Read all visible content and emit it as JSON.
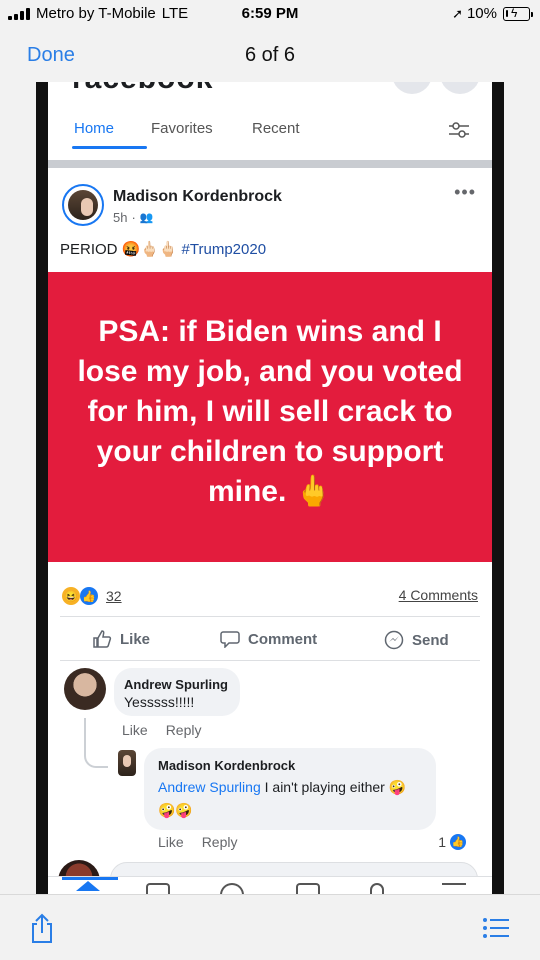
{
  "status_bar": {
    "carrier": "Metro by T-Mobile",
    "network": "LTE",
    "time": "6:59 PM",
    "battery": "10%",
    "battery_level": 0.1
  },
  "viewer": {
    "done_label": "Done",
    "counter": "6 of 6"
  },
  "facebook": {
    "logo_partial": "racebook",
    "tabs": [
      {
        "label": "Home",
        "active": true
      },
      {
        "label": "Favorites",
        "active": false
      },
      {
        "label": "Recent",
        "active": false
      }
    ],
    "post": {
      "author": "Madison Kordenbrock",
      "time": "5h",
      "text_prefix": "PERIOD",
      "emojis": "🤬🖕🏻🖕🏻",
      "hashtag": "#Trump2020",
      "image_text": "PSA: if Biden wins and I lose my job, and you voted for him, I will sell crack to your children to support mine. 🖕",
      "reaction_count": "32",
      "comments_label": "4 Comments",
      "actions": {
        "like": "Like",
        "comment": "Comment",
        "send": "Send"
      }
    },
    "comments": [
      {
        "author": "Andrew Spurling",
        "text": "Yesssss!!!!!",
        "like": "Like",
        "reply": "Reply"
      },
      {
        "author": "Madison Kordenbrock",
        "mention": "Andrew Spurling",
        "text": "I ain't playing either 🤪",
        "emoji_line": "🤪🤪",
        "like": "Like",
        "reply": "Reply",
        "like_count": "1"
      }
    ]
  },
  "colors": {
    "ios_blue": "#2a7ee6",
    "facebook_blue": "#1877f2",
    "psa_red": "#e31c3d"
  }
}
